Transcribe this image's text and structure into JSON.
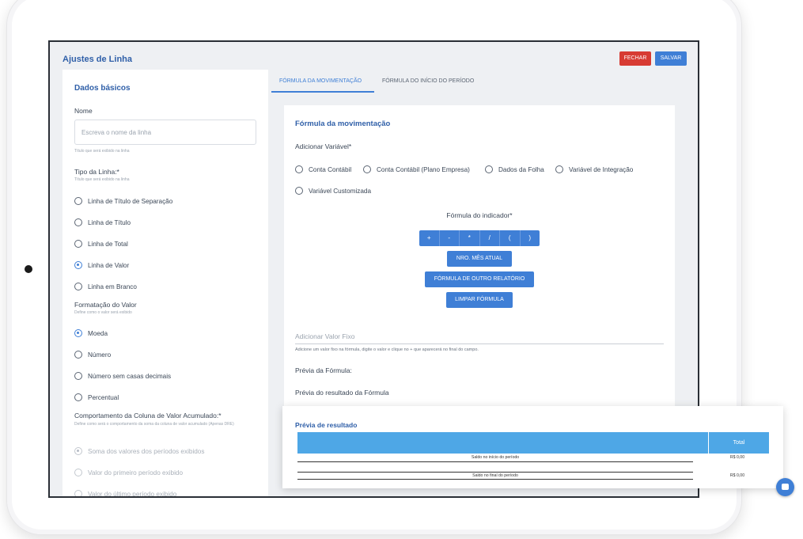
{
  "window": {
    "title": "Ajustes de Linha"
  },
  "header": {
    "close_label": "FECHAR",
    "save_label": "SALVAR"
  },
  "basic": {
    "title": "Dados básicos",
    "name_label": "Nome",
    "name_placeholder": "Escreva o nome da linha",
    "name_hint": "Título que será exibido na linha",
    "type_label": "Tipo da Linha:*",
    "type_hint": "Título que será exibido na linha",
    "type_options": [
      "Linha de Título de Separação",
      "Linha de Título",
      "Linha de Total",
      "Linha de Valor",
      "Linha em Branco"
    ],
    "type_selected": "Linha de Valor",
    "format_label": "Formatação do Valor",
    "format_hint": "Define como o valor será exibido",
    "format_options": [
      "Moeda",
      "Número",
      "Número sem casas decimais",
      "Percentual"
    ],
    "format_selected": "Moeda",
    "behavior_label": "Comportamento da Coluna de Valor Acumulado:*",
    "behavior_hint": "Define como será o comportamento da soma da coluna de valor acumulado (Apenas DRE)",
    "behavior_options": [
      "Soma dos valores dos períodos exibidos",
      "Valor do primeiro período exibido",
      "Valor do último período exibido"
    ],
    "behavior_selected": "Soma dos valores dos períodos exibidos"
  },
  "tabs": [
    "FÓRMULA DA MOVIMENTAÇÃO",
    "FÓRMULA DO INÍCIO DO PERÍODO"
  ],
  "formula": {
    "title": "Fórmula da movimentação",
    "add_variable_label": "Adicionar Variável*",
    "variable_options": [
      "Conta Contábil",
      "Conta Contábil (Plano Empresa)",
      "Dados da Folha",
      "Variável de Integração",
      "Variável Customizada"
    ],
    "indicator_label": "Fórmula do indicador*",
    "operators": [
      "+",
      "-",
      "*",
      "/",
      "(",
      ")"
    ],
    "month_button": "NRO. MÊS ATUAL",
    "other_report_button": "FÓRMULA DE OUTRO RELATÓRIO",
    "clear_button": "LIMPAR FÓRMULA",
    "fixed_value_placeholder": "Adicionar Valor Fixo",
    "fixed_value_hint": "Adicione um valor fixo na fórmula, digite o valor e clique no + que aparecerá no final do campo.",
    "preview_label": "Prévia da Fórmula:",
    "result_preview_label": "Prévia do resultado da Fórmula"
  },
  "preview": {
    "title": "Prévia de resultado",
    "total_header": "Total",
    "rows": [
      {
        "label": "Saldo no início do período",
        "value": "R$ 0,00"
      },
      {
        "label": "Saldo no final do período",
        "value": "R$ 0,00"
      }
    ]
  },
  "colors": {
    "primary": "#3f7fd6",
    "danger": "#d73b33",
    "title": "#2f5fa8",
    "table_header": "#4ea7e6"
  }
}
